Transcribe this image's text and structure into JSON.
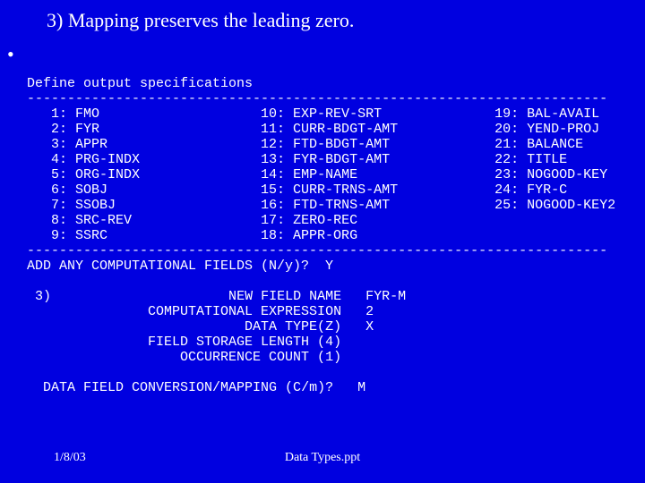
{
  "title": "3)  Mapping preserves the leading zero.",
  "define_line": "Define output specifications",
  "hr": "------------------------------------------------------------------------",
  "cols": {
    "c1": [
      "   1: FMO",
      "   2: FYR",
      "   3: APPR",
      "   4: PRG-INDX",
      "   5: ORG-INDX",
      "   6: SOBJ",
      "   7: SSOBJ",
      "   8: SRC-REV",
      "   9: SSRC"
    ],
    "c2": [
      "10: EXP-REV-SRT",
      "11: CURR-BDGT-AMT",
      "12: FTD-BDGT-AMT",
      "13: FYR-BDGT-AMT",
      "14: EMP-NAME",
      "15: CURR-TRNS-AMT",
      "16: FTD-TRNS-AMT",
      "17: ZERO-REC",
      "18: APPR-ORG"
    ],
    "c3": [
      "19: BAL-AVAIL",
      "20: YEND-PROJ",
      "21: BALANCE",
      "22: TITLE",
      "23: NOGOOD-KEY",
      "24: FYR-C",
      "25: NOGOOD-KEY2"
    ]
  },
  "prompt_add": "ADD ANY COMPUTATIONAL FIELDS (N/y)?  Y",
  "step_marker": " 3)",
  "form": {
    "l1": "          NEW FIELD NAME   FYR-M",
    "l2": "COMPUTATIONAL EXPRESSION   2",
    "l3": "            DATA TYPE(Z)   X",
    "l4": "FIELD STORAGE LENGTH (4)",
    "l5": "    OCCURRENCE COUNT (1)"
  },
  "prompt_map": "DATA FIELD CONVERSION/MAPPING (C/m)?   M",
  "footer_date": "1/8/03",
  "footer_title": "Data Types.ppt"
}
